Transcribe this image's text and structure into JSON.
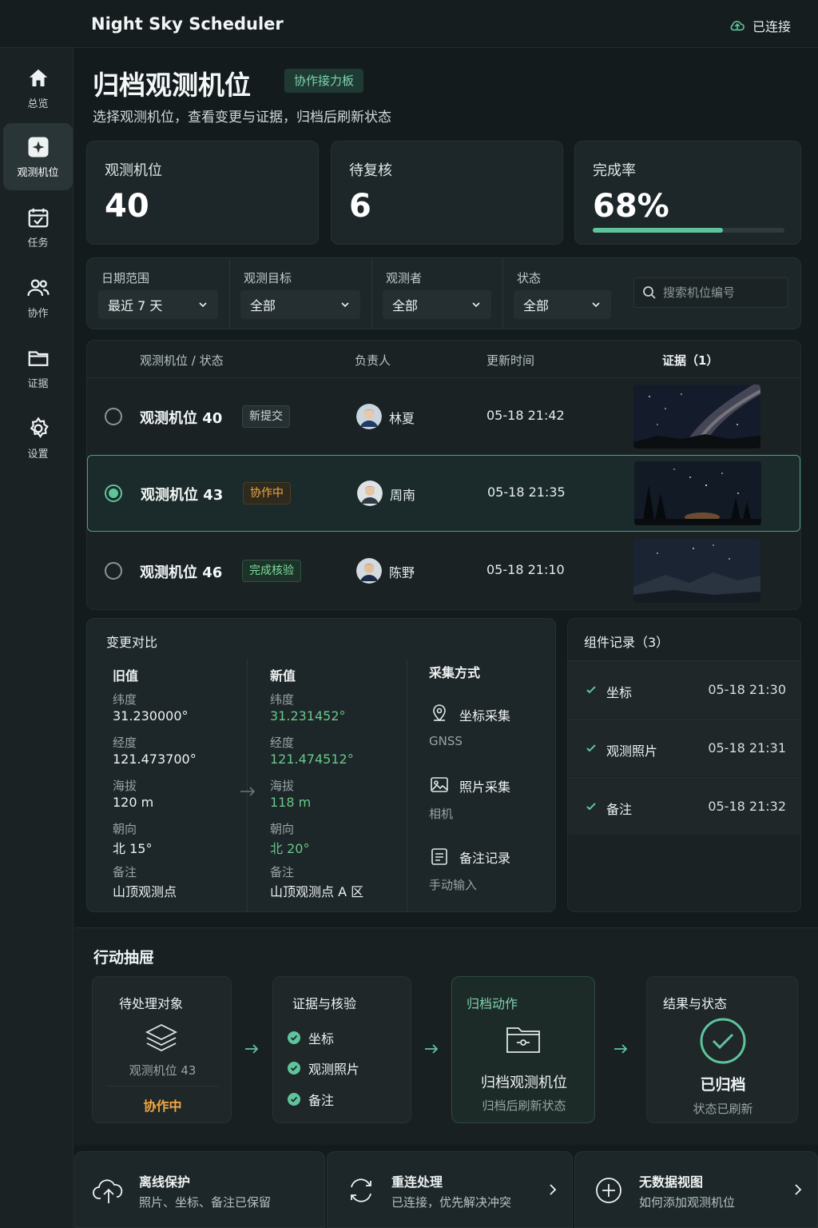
{
  "app": {
    "title": "Night Sky Scheduler",
    "connection": "已连接"
  },
  "sidebar": {
    "items": [
      {
        "label": "总览",
        "icon": "home-icon",
        "active": false
      },
      {
        "label": "观测机位",
        "icon": "telescope-icon",
        "active": true
      },
      {
        "label": "任务",
        "icon": "task-calendar-icon",
        "active": false
      },
      {
        "label": "协作",
        "icon": "users-icon",
        "active": false
      },
      {
        "label": "证据",
        "icon": "folder-icon",
        "active": false
      },
      {
        "label": "设置",
        "icon": "gear-icon",
        "active": false
      }
    ]
  },
  "header": {
    "title": "归档观测机位",
    "tag": "协作接力板",
    "subtitle": "选择观测机位，查看变更与证据，归档后刷新状态"
  },
  "stats": [
    {
      "label": "观测机位",
      "value": "40"
    },
    {
      "label": "待复核",
      "value": "6"
    },
    {
      "label": "完成率",
      "value": "68%",
      "progress": 0.68
    }
  ],
  "filters": {
    "date": {
      "label": "日期范围",
      "value": "最近 7 天"
    },
    "target": {
      "label": "观测目标",
      "value": "全部"
    },
    "observer": {
      "label": "观测者",
      "value": "全部"
    },
    "status": {
      "label": "状态",
      "value": "全部"
    },
    "search_placeholder": "搜索机位编号"
  },
  "table": {
    "headers": {
      "name": "观测机位 / 状态",
      "owner": "负责人",
      "updated": "更新时间",
      "evidence": "证据（1）"
    },
    "rows": [
      {
        "name": "观测机位 40",
        "status": "新提交",
        "owner": "林夏",
        "time": "05-18 21:42",
        "selected": false
      },
      {
        "name": "观测机位 43",
        "status": "协作中",
        "owner": "周南",
        "time": "05-18 21:35",
        "selected": true
      },
      {
        "name": "观测机位 46",
        "status": "完成核验",
        "owner": "陈野",
        "time": "05-18 21:10",
        "selected": false
      }
    ]
  },
  "diff": {
    "title": "变更对比",
    "old_header": "旧值",
    "new_header": "新值",
    "method_header": "采集方式",
    "fields": [
      {
        "key": "纬度",
        "old": "31.230000°",
        "new": "31.231452°"
      },
      {
        "key": "经度",
        "old": "121.473700°",
        "new": "121.474512°"
      },
      {
        "key": "海拔",
        "old": "120 m",
        "new": "118 m"
      },
      {
        "key": "朝向",
        "old": "北 15°",
        "new": "北 20°"
      },
      {
        "key": "备注",
        "old": "山顶观测点",
        "new": "山顶观测点 A 区"
      }
    ],
    "methods": [
      {
        "name": "坐标采集",
        "sub": "GNSS",
        "icon": "location-pin-icon"
      },
      {
        "name": "照片采集",
        "sub": "相机",
        "icon": "photo-icon"
      },
      {
        "name": "备注记录",
        "sub": "手动输入",
        "icon": "note-icon"
      }
    ]
  },
  "components": {
    "title": "组件记录（3）",
    "items": [
      {
        "name": "坐标",
        "time": "05-18 21:30"
      },
      {
        "name": "观测照片",
        "time": "05-18 21:31"
      },
      {
        "name": "备注",
        "time": "05-18 21:32"
      }
    ]
  },
  "drawer": {
    "title": "行动抽屉",
    "pending": {
      "title": "待处理对象",
      "item": "观测机位 43",
      "status": "协作中"
    },
    "evidence": {
      "title": "证据与核验",
      "items": [
        "坐标",
        "观测照片",
        "备注"
      ]
    },
    "action": {
      "title": "归档动作",
      "name": "归档观测机位",
      "sub": "归档后刷新状态"
    },
    "result": {
      "title": "结果与状态",
      "name": "已归档",
      "sub": "状态已刷新"
    }
  },
  "bottom": [
    {
      "title": "离线保护",
      "sub": "照片、坐标、备注已保留"
    },
    {
      "title": "重连处理",
      "sub": "已连接，优先解决冲突"
    },
    {
      "title": "无数据视图",
      "sub": "如何添加观测机位"
    }
  ],
  "colors": {
    "accent": "#5fc49c",
    "warning": "#f0a843",
    "success": "#69c889",
    "background": "#141b1d"
  }
}
